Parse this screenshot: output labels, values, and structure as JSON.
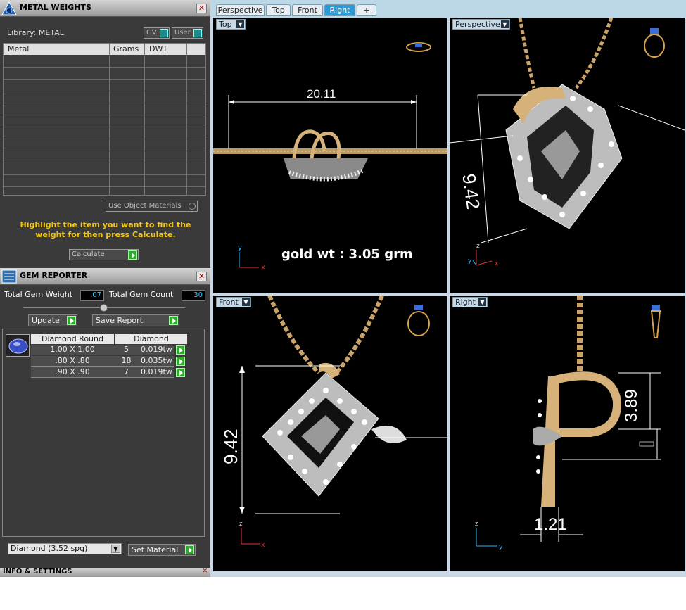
{
  "metal_panel": {
    "title": "METAL WEIGHTS",
    "library_label": "Library: METAL",
    "gv_label": "GV",
    "user_label": "User",
    "columns": [
      "Metal",
      "Grams",
      "DWT"
    ],
    "use_object_materials": "Use Object Materials",
    "instruction": "Highlight the item you want to find the weight for then press Calculate.",
    "calculate_label": "Calculate"
  },
  "gem_panel": {
    "title": "GEM REPORTER",
    "total_weight_label": "Total Gem Weight",
    "total_weight_value": ".07",
    "total_count_label": "Total Gem Count",
    "total_count_value": "30",
    "update_label": "Update",
    "save_report_label": "Save Report",
    "col_shape": "Diamond Round",
    "col_type": "Diamond",
    "rows": [
      {
        "size": "1.00 X 1.00",
        "count": "5",
        "weight": "0.019tw"
      },
      {
        "size": ".80 X .80",
        "count": "18",
        "weight": "0.035tw"
      },
      {
        "size": ".90 X .90",
        "count": "7",
        "weight": "0.019tw"
      }
    ],
    "material_select": "Diamond     (3.52 spg)",
    "set_material_label": "Set Material"
  },
  "info_panel": {
    "title": "INFO & SETTINGS"
  },
  "tabs": [
    "Perspective",
    "Top",
    "Front",
    "Right",
    "+"
  ],
  "active_tab": "Right",
  "viewports": {
    "top": {
      "label": "Top",
      "dimension": "20.11",
      "note": "gold wt : 3.05 grm"
    },
    "perspective": {
      "label": "Perspective",
      "dimension": "9.42"
    },
    "front": {
      "label": "Front",
      "dimension": "9.42"
    },
    "right": {
      "label": "Right",
      "dimension_a": "3.89",
      "dimension_b": "1.21"
    }
  },
  "colors": {
    "accent_tab": "#2b9bd6",
    "instruction_text": "#f5c814",
    "gold": "#d6b27a",
    "gem_count": "#29c6ff"
  },
  "icons": [
    "app-logo-icon",
    "close-icon",
    "gem-icon",
    "ring-preview-icon",
    "dropdown-arrow-icon",
    "play-icon"
  ]
}
